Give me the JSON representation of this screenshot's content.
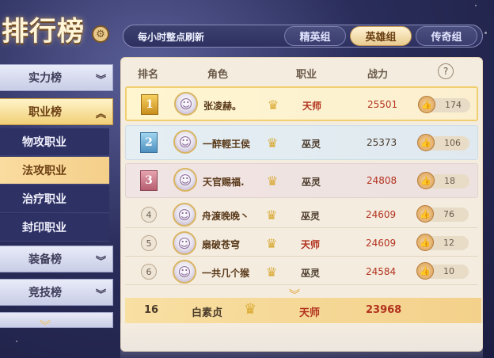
{
  "header": {
    "title": "排行榜",
    "refresh_text": "每小时整点刷新",
    "gear_icon": "gear-icon"
  },
  "tabs": [
    {
      "label": "精英组",
      "active": false
    },
    {
      "label": "英雄组",
      "active": true
    },
    {
      "label": "传奇组",
      "active": false
    }
  ],
  "menu": {
    "items": [
      {
        "label": "实力榜",
        "active": false,
        "expanded": false
      },
      {
        "label": "职业榜",
        "active": true,
        "expanded": true
      },
      {
        "label": "装备榜",
        "active": false,
        "expanded": false
      },
      {
        "label": "竞技榜",
        "active": false,
        "expanded": false
      }
    ],
    "subitems": [
      {
        "label": "物攻职业",
        "active": false
      },
      {
        "label": "法攻职业",
        "active": true
      },
      {
        "label": "治疗职业",
        "active": false
      },
      {
        "label": "封印职业",
        "active": false
      }
    ]
  },
  "table": {
    "headers": [
      "排名",
      "角色",
      "职业",
      "战力"
    ],
    "help_label": "?",
    "rows": [
      {
        "rank": "1",
        "name": "张凌赫。",
        "job": "天师",
        "power": "25501",
        "likes": "174"
      },
      {
        "rank": "2",
        "name": "一醉輕王侯",
        "job": "巫灵",
        "power": "25373",
        "likes": "106"
      },
      {
        "rank": "3",
        "name": "天官赐福.",
        "job": "巫灵",
        "power": "24808",
        "likes": "18"
      },
      {
        "rank": "4",
        "name": "舟渡晚晚丶",
        "job": "巫灵",
        "power": "24609",
        "likes": "76"
      },
      {
        "rank": "5",
        "name": "扇破苍穹",
        "job": "天师",
        "power": "24609",
        "likes": "12"
      },
      {
        "rank": "6",
        "name": "一共几个猴",
        "job": "巫灵",
        "power": "24584",
        "likes": "10"
      }
    ]
  },
  "self": {
    "rank": "16",
    "name": "白素贞",
    "job": "天师",
    "power": "23968"
  },
  "colors": {
    "accent_gold": "#f1cf77",
    "power_red": "#b2321e",
    "panel_bg": "#f4ecdf"
  }
}
